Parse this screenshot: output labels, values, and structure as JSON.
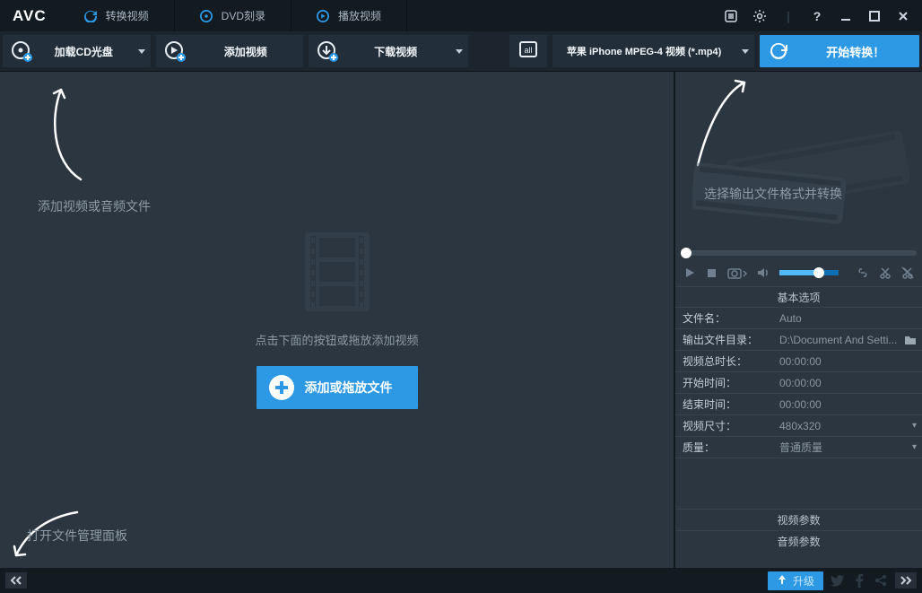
{
  "logo": "AVC",
  "tabs": [
    {
      "label": "转换视频",
      "icon": "refresh"
    },
    {
      "label": "DVD刻录",
      "icon": "disc"
    },
    {
      "label": "播放视频",
      "icon": "play"
    }
  ],
  "toolbar": {
    "load_disc": "加载CD光盘",
    "add_video": "添加视频",
    "download": "下载视频",
    "profile": "苹果 iPhone MPEG-4 视频 (*.mp4)",
    "start": "开始转换！"
  },
  "dropzone": {
    "hint": "点击下面的按钮或拖放添加视频",
    "add": "添加或拖放文件"
  },
  "annotations": {
    "left1": "添加视频或音频文件",
    "left2": "打开文件管理面板",
    "right": "选择输出文件格式并转换"
  },
  "panel": {
    "basic_header": "基本选项",
    "rows": [
      {
        "k": "文件名：",
        "v": "Auto",
        "type": "text"
      },
      {
        "k": "输出文件目录：",
        "v": "D:\\Document And Setti...",
        "type": "browse"
      },
      {
        "k": "视频总时长：",
        "v": "00:00:00",
        "type": "text"
      },
      {
        "k": "开始时间：",
        "v": "00:00:00",
        "type": "text"
      },
      {
        "k": "结束时间：",
        "v": "00:00:00",
        "type": "text"
      },
      {
        "k": "视频尺寸：",
        "v": "480x320",
        "type": "dd"
      },
      {
        "k": "质量：",
        "v": "普通质量",
        "type": "dd"
      }
    ],
    "video_params": "视频参数",
    "audio_params": "音频参数"
  },
  "statusbar": {
    "upgrade": "升级"
  }
}
